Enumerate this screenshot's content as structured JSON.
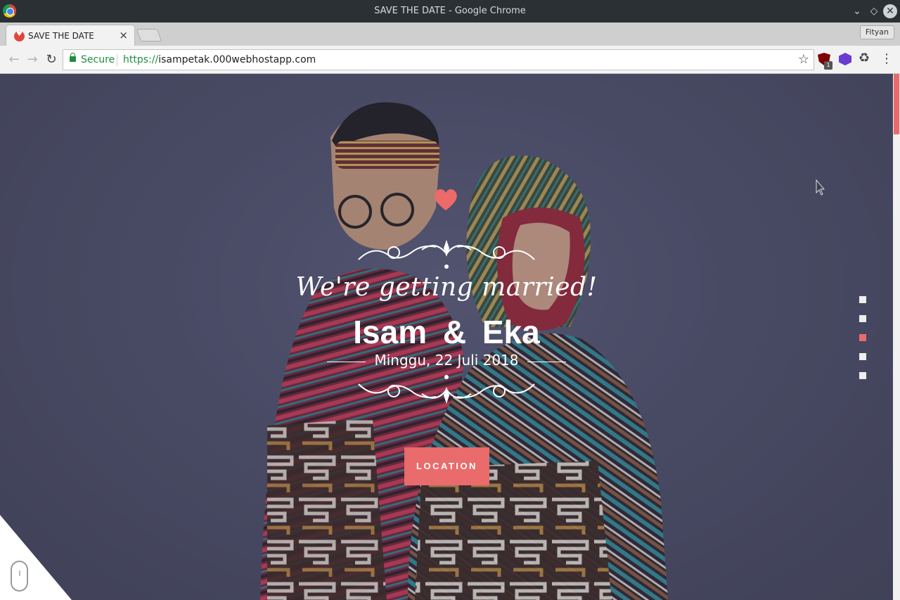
{
  "window": {
    "title": "SAVE THE DATE - Google Chrome"
  },
  "tabs": [
    {
      "title": "SAVE THE DATE",
      "close": "×",
      "favicon": "heart-favicon-icon"
    }
  ],
  "profile": {
    "name": "Fityan"
  },
  "toolbar": {
    "back": "←",
    "forward": "→",
    "reload": "↻",
    "secure_label": "Secure",
    "url_scheme": "https://",
    "url_host": "isampetak.000webhostapp.com",
    "star": "☆",
    "extension_badge": "1",
    "recycle": "♻",
    "menu": "⋮"
  },
  "page": {
    "tagline": "We're getting married!",
    "names": "Isam & Eka",
    "date": "Minggu, 22 Juli 2018",
    "cta_label": "LOCATION",
    "accent_color": "#ec6a6a",
    "section_dots": 5,
    "active_dot": 3
  }
}
